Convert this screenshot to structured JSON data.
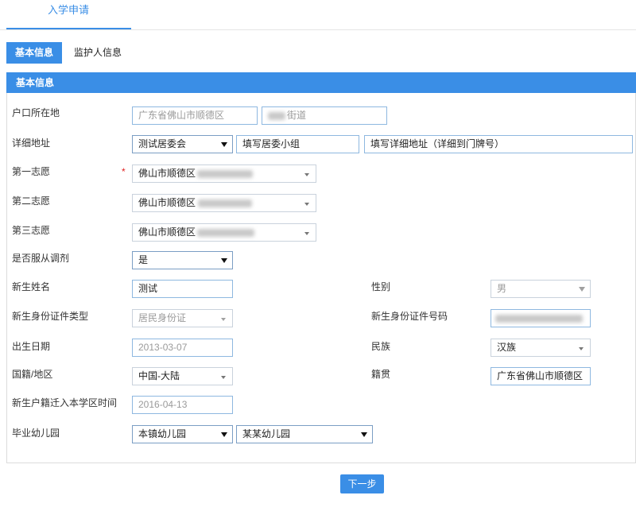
{
  "page": {
    "top_tab": "入学申请",
    "tabs": [
      {
        "label": "基本信息",
        "active": true
      },
      {
        "label": "监护人信息",
        "active": false
      }
    ],
    "section_title": "基本信息",
    "next_button": "下一步"
  },
  "form": {
    "household": {
      "label": "户口所在地",
      "district": "广东省佛山市顺德区",
      "street": "街道"
    },
    "address": {
      "label": "详细地址",
      "committee": "测试居委会",
      "group": "填写居委小组",
      "detail": "填写详细地址（详细到门牌号）"
    },
    "choice1": {
      "label": "第一志愿",
      "required_mark": "*",
      "value": "佛山市顺德区"
    },
    "choice2": {
      "label": "第二志愿",
      "value": "佛山市顺德区"
    },
    "choice3": {
      "label": "第三志愿",
      "value": "佛山市顺德区"
    },
    "adjust": {
      "label": "是否服从调剂",
      "value": "是"
    },
    "name": {
      "label": "新生姓名",
      "value": "测试"
    },
    "gender": {
      "label": "性别",
      "value": "男"
    },
    "id_type": {
      "label": "新生身份证件类型",
      "value": "居民身份证"
    },
    "id_number": {
      "label": "新生身份证件号码"
    },
    "birth": {
      "label": "出生日期",
      "value": "2013-03-07"
    },
    "ethnicity": {
      "label": "民族",
      "value": "汉族"
    },
    "nationality": {
      "label": "国籍/地区",
      "value": "中国-大陆"
    },
    "native_place": {
      "label": "籍贯",
      "value": "广东省佛山市顺德区"
    },
    "move_in": {
      "label": "新生户籍迁入本学区时间",
      "value": "2016-04-13"
    },
    "kindergarten": {
      "label": "毕业幼儿园",
      "town": "本镇幼儿园",
      "school": "某某幼儿园"
    }
  },
  "icons": {
    "select_arrow": "caret-down-icon",
    "select_arrow_small": "small-caret-down-icon"
  },
  "colors": {
    "accent": "#3a8ee6",
    "required": "#e02020",
    "input_border": "#8eb8e0"
  }
}
